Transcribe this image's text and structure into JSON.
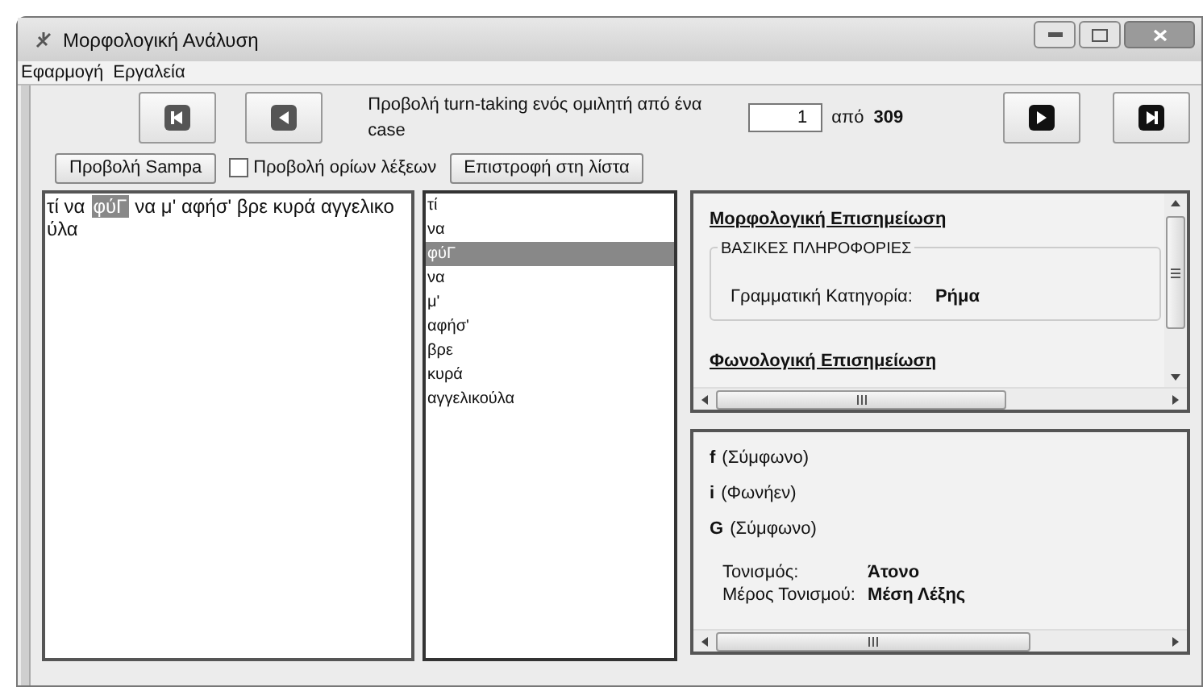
{
  "window": {
    "title": "Μορφολογική Ανάλυση"
  },
  "menu": [
    "Εφαρμογή",
    "Εργαλεία"
  ],
  "navigation": {
    "label": "Προβολή turn-taking ενός ομιλητή από ένα case",
    "value": "1",
    "of_label": "από",
    "total": "309"
  },
  "toolbar": {
    "sampa_button": "Προβολή Sampa",
    "word_bounds": {
      "label": "Προβολή ορίων λέξεων",
      "checked": false
    },
    "back_button": "Επιστροφή στη λίστα"
  },
  "transcript": {
    "lines": [
      [
        {
          "text": "τί να",
          "highlighted": false
        },
        {
          "text": "φύΓ",
          "highlighted": true
        },
        {
          "text": "να μ' αφήσ' βρε κυρά αγγελικο",
          "highlighted": false
        }
      ],
      [
        {
          "text": "ύλα",
          "highlighted": false
        }
      ]
    ]
  },
  "words": [
    {
      "text": "τί",
      "selected": false
    },
    {
      "text": "να",
      "selected": false
    },
    {
      "text": "φύΓ",
      "selected": true
    },
    {
      "text": "να",
      "selected": false
    },
    {
      "text": "μ'",
      "selected": false
    },
    {
      "text": "αφήσ'",
      "selected": false
    },
    {
      "text": "βρε",
      "selected": false
    },
    {
      "text": "κυρά",
      "selected": false
    },
    {
      "text": "αγγελικούλα",
      "selected": false
    }
  ],
  "morphology": {
    "heading": "Μορφολογική Επισημείωση",
    "group_title": "ΒΑΣΙΚΕΣ ΠΛΗΡΟΦΟΡΙΕΣ",
    "field_label": "Γραμματική Κατηγορία:",
    "field_value": "Ρήμα",
    "next_heading": "Φωνολογική Επισημείωση"
  },
  "phonology": {
    "phonemes": [
      {
        "symbol": "f",
        "type": "(Σύμφωνο)"
      },
      {
        "symbol": "i",
        "type": "(Φωνήεν)"
      },
      {
        "symbol": "G",
        "type": "(Σύμφωνο)"
      }
    ],
    "stress": [
      {
        "label": "Τονισμός:",
        "value": "Άτονο"
      },
      {
        "label": "Μέρος Τονισμού:",
        "value": "Μέση Λέξης"
      }
    ]
  }
}
